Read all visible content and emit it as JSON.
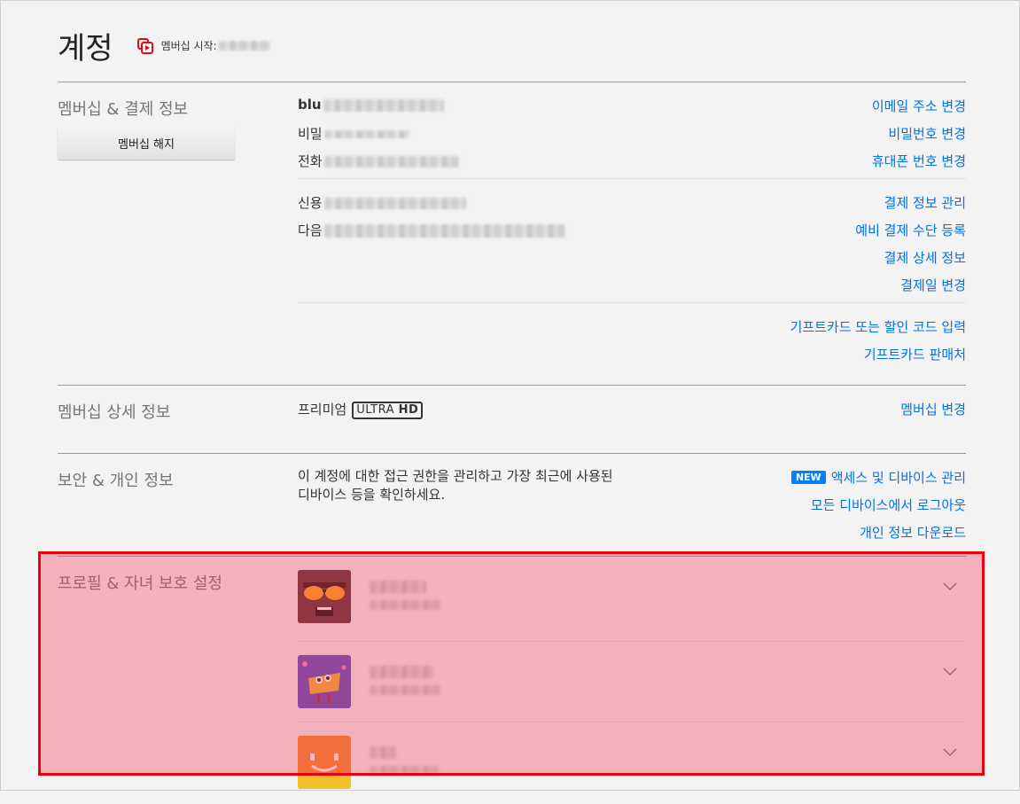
{
  "header": {
    "title": "계정",
    "member_since_label": "멤버십 시작:"
  },
  "membership_billing": {
    "title": "멤버십 & 결제 정보",
    "cancel_button": "멤버십 해지",
    "email_prefix": "blu",
    "password_prefix": "비밀",
    "phone_prefix": "전화",
    "card_prefix": "신용",
    "next_billing_prefix": "다음",
    "links": {
      "change_email": "이메일 주소 변경",
      "change_password": "비밀번호 변경",
      "change_phone": "휴대폰 번호 변경",
      "manage_payment": "결제 정보 관리",
      "add_backup_payment": "예비 결제 수단 등록",
      "billing_details": "결제 상세 정보",
      "change_billing_day": "결제일 변경",
      "redeem_gift": "기프트카드 또는 할인 코드 입력",
      "where_to_buy_gift": "기프트카드 판매처"
    }
  },
  "plan_details": {
    "title": "멤버십 상세 정보",
    "plan_name": "프리미엄",
    "badge_ultra": "ULTRA",
    "badge_hd": "HD",
    "change_plan": "멤버십 변경"
  },
  "security": {
    "title": "보안 & 개인 정보",
    "description": "이 계정에 대한 접근 권한을 관리하고 가장 최근에 사용된 디바이스 등을 확인하세요.",
    "new_badge": "NEW",
    "links": {
      "manage_access": "액세스 및 디바이스 관리",
      "sign_out_all": "모든 디바이스에서 로그아웃",
      "download_info": "개인 정보 다운로드"
    }
  },
  "profiles": {
    "title": "프로필 & 자녀 보호 설정",
    "avatar_colors": [
      "#4a2a2a",
      "#5b4fc2",
      "#f28a2a"
    ],
    "icons": [
      "chevron-down-icon"
    ]
  },
  "highlight_color": "#e8000a"
}
